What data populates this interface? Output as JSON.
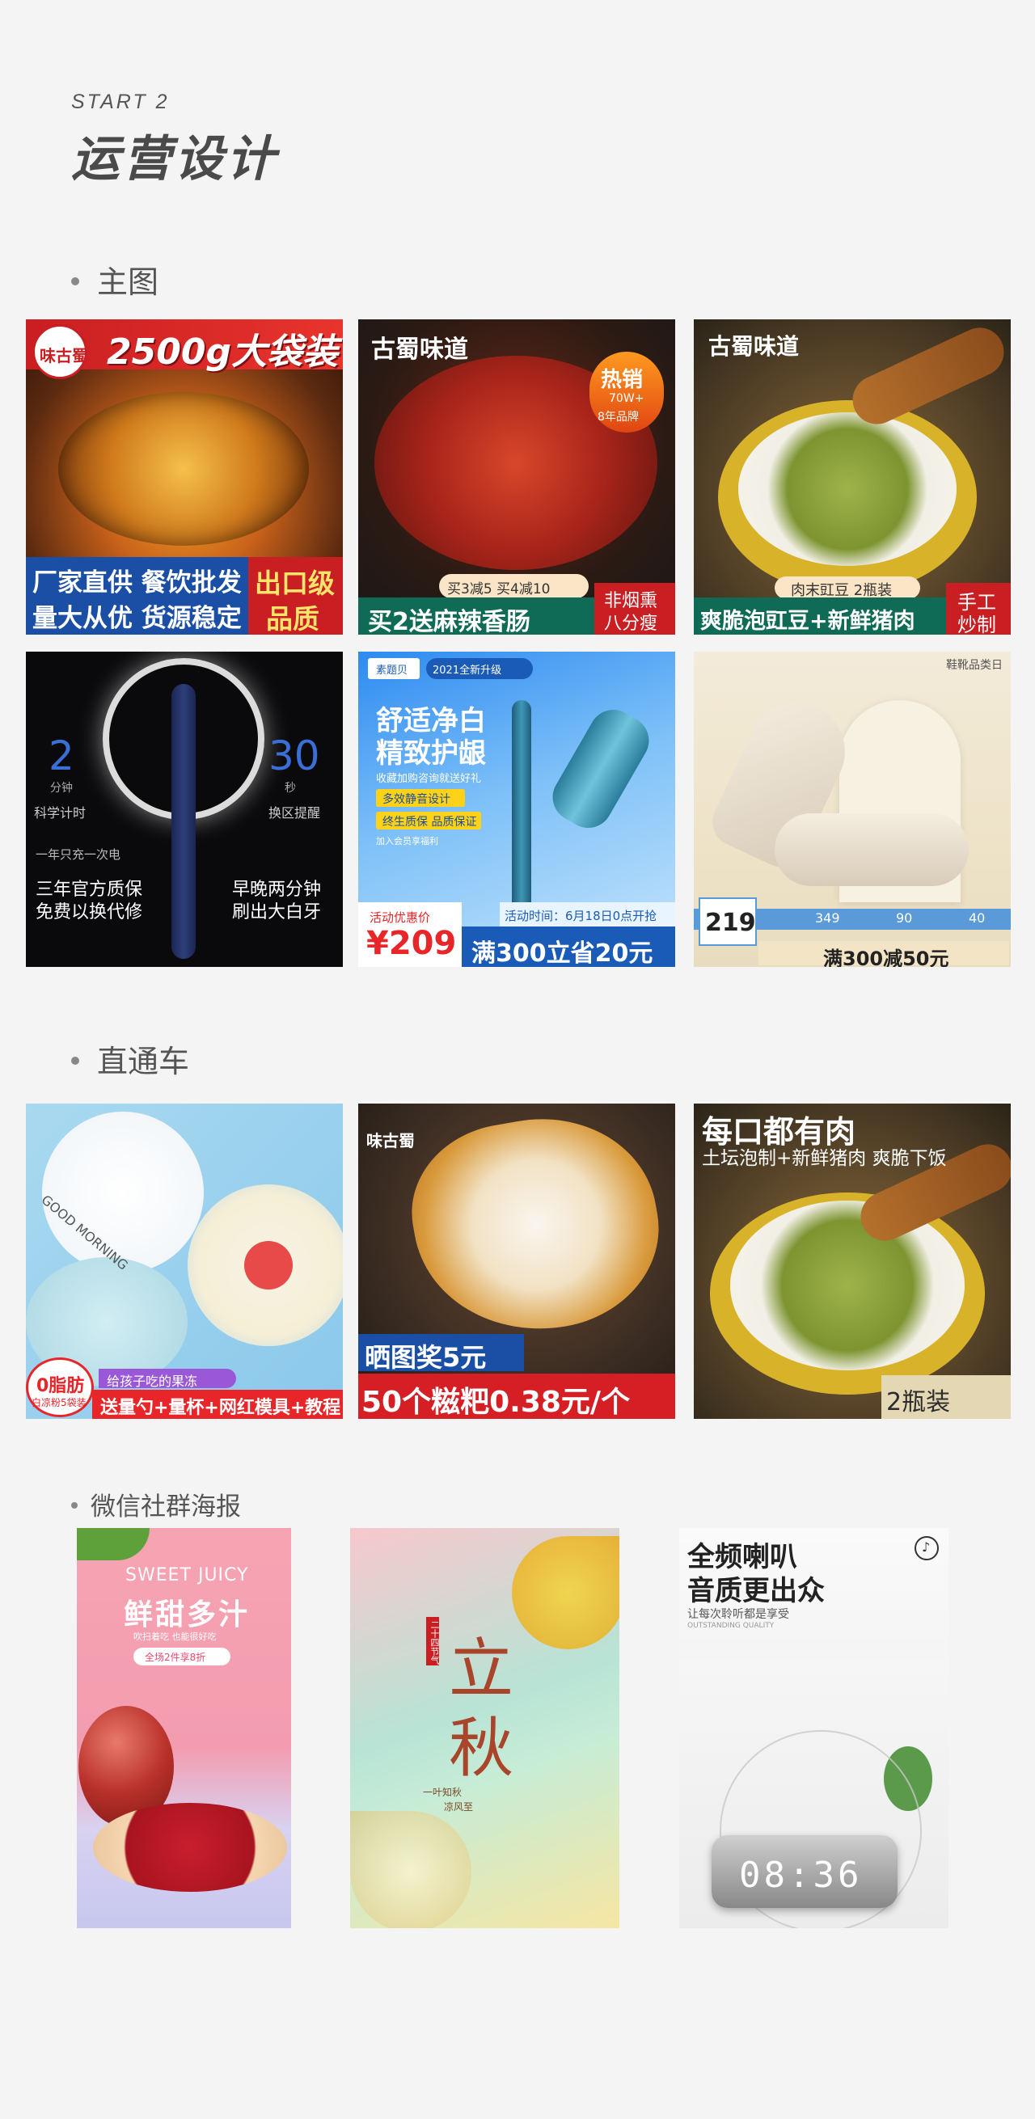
{
  "header": {
    "start": "START 2",
    "title": "运营设计"
  },
  "sections": {
    "main_image": "主图",
    "through_train": "直通车",
    "wechat_poster": "微信社群海报"
  },
  "tiles": {
    "t1": {
      "logo": "味古蜀",
      "headline": "2500g大袋装",
      "line1": "厂家直供 餐饮批发",
      "line2": "量大从优 货源稳定",
      "badge1": "出口级",
      "badge2": "品质"
    },
    "t2": {
      "brand": "古蜀味道",
      "hot1": "热销",
      "hot2": "70W+",
      "hot3": "8年品牌",
      "promo": "买3减5 买4减10",
      "bottom": "买2送麻辣香肠",
      "badge1": "非烟熏",
      "badge2": "八分瘦"
    },
    "t3": {
      "brand": "古蜀味道",
      "pill": "肉末豇豆 2瓶装",
      "bottom": "爽脆泡豇豆+新鲜猪肉",
      "badge1": "手工",
      "badge2": "炒制"
    },
    "t4": {
      "n2": "2",
      "n2sub": "分钟",
      "n30": "30",
      "n30sub": "秒",
      "scaption1": "科学计时",
      "scaption2": "换区提醒",
      "once": "一年只充一次电",
      "w1": "三年官方质保",
      "w2": "免费以换代修",
      "w3": "早晚两分钟",
      "w4": "刷出大白牙"
    },
    "t5": {
      "tag1": "素题贝",
      "tag2": "2021全新升级",
      "h1": "舒适净白",
      "h2": "精致护龈",
      "sub": "收藏加购咨询就送好礼",
      "chip1": "多效静音设计",
      "chip2": "终生质保 品质保证",
      "mini": "加入会员享福利",
      "time": "活动时间：6月18日0点开抢",
      "price_label": "活动优惠价",
      "price": "¥209",
      "bottom": "满300立省20元"
    },
    "t6": {
      "top": "鞋靴品类日",
      "bigp": "219",
      "a": "349",
      "b": "90",
      "c": "40",
      "bottom": "满300减50元"
    },
    "t7": {
      "gm": "GOOD MORNING",
      "tag1": "0脂肪",
      "tag2": "白凉粉5袋装",
      "purple": "给孩子吃的果冻",
      "bottom": "送量勺+量杯+网红模具+教程"
    },
    "t8": {
      "logo": "味古蜀",
      "pill": "晒图奖5元",
      "bottom": "50个糍粑0.38元/个"
    },
    "t9": {
      "h1": "每口都有肉",
      "h2": "土坛泡制+新鲜猪肉 爽脆下饭",
      "pack": "2瓶装"
    }
  },
  "posters": {
    "p1": {
      "en": "SWEET JUICY",
      "cn": "鲜甜多汁",
      "sub": "吹扫着吃 也能很好吃",
      "chip": "全场2件享8折"
    },
    "p2": {
      "seal": "二十四节气",
      "c1": "立",
      "c2": "秋",
      "sm1": "一叶知秋",
      "sm2": "凉风至"
    },
    "p3": {
      "h1": "全频喇叭",
      "h2": "音质更出众",
      "sub": "让每次聆听都是享受",
      "sub2": "OUTSTANDING QUALITY",
      "tik": "♪",
      "clock": "08:36"
    }
  }
}
